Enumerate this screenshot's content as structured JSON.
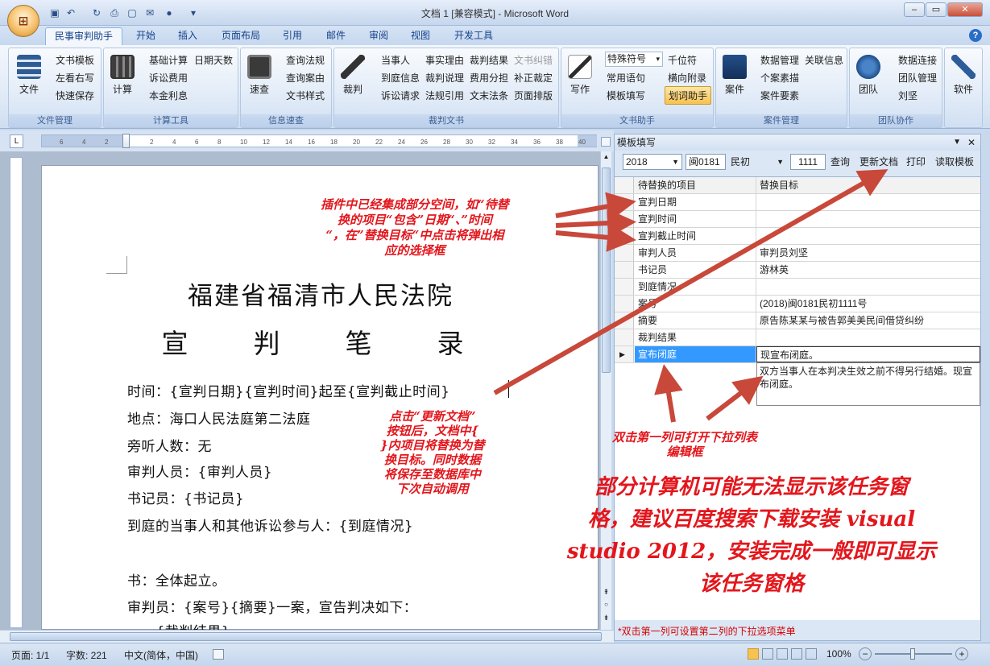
{
  "window": {
    "title": "文档 1 [兼容模式] - Microsoft Word",
    "office_button": "Office",
    "min": "–",
    "max": "▭",
    "close": "✕"
  },
  "quick_access": [
    "save-icon",
    "undo-icon",
    "redo-icon",
    "print-preview-icon",
    "new-icon",
    "mail-icon",
    "spell-icon"
  ],
  "tabs": [
    "民事审判助手",
    "开始",
    "插入",
    "页面布局",
    "引用",
    "邮件",
    "审阅",
    "视图",
    "开发工具"
  ],
  "active_tab": "民事审判助手",
  "help": "?",
  "ribbon": {
    "file_mgmt": {
      "title": "文件管理",
      "big": "文件",
      "items": [
        "文书模板",
        "左看右写",
        "快速保存"
      ]
    },
    "calc": {
      "title": "计算工具",
      "big": "计算",
      "items": [
        "基础计算",
        "日期天数",
        "诉讼费用",
        "本金利息"
      ]
    },
    "info": {
      "title": "信息速查",
      "big": "速查",
      "items": [
        "查询法规",
        "查询案由",
        "文书样式"
      ]
    },
    "judgment": {
      "title": "裁判文书",
      "big": "裁判",
      "items": [
        "当事人",
        "事实理由",
        "裁判结果",
        "文书纠错",
        "到庭信息",
        "裁判说理",
        "费用分担",
        "补正裁定",
        "诉讼请求",
        "法规引用",
        "文末法条",
        "页面排版"
      ]
    },
    "assistant": {
      "title": "文书助手",
      "big": "写作",
      "items": [
        "特殊符号",
        "千位符",
        "常用语句",
        "横向附录",
        "模板填写",
        "划词助手"
      ]
    },
    "case_mgmt": {
      "title": "案件管理",
      "big": "案件",
      "items": [
        "数据管理",
        "关联信息",
        "个案素描",
        "案件要素"
      ]
    },
    "team": {
      "title": "团队协作",
      "big": "团队",
      "items": [
        "数据连接",
        "团队管理",
        "刘坚"
      ]
    },
    "software": {
      "big": "软件"
    }
  },
  "ruler": {
    "ticks": [
      "6",
      "4",
      "2",
      "",
      "2",
      "4",
      "6",
      "8",
      "10",
      "12",
      "14",
      "16",
      "18",
      "20",
      "22",
      "24",
      "26",
      "28",
      "30",
      "32",
      "34",
      "36",
      "38",
      "40"
    ]
  },
  "document": {
    "court": "福建省福清市人民法院",
    "doc_title": "宣  判  笔  录",
    "lines": [
      "时间：{宣判日期}{宣判时间}起至{宣判截止时间}",
      "地点：海口人民法庭第二法庭",
      "旁听人数：无",
      "审判人员：{审判人员}",
      "书记员：{书记员}",
      "到庭的当事人和其他诉讼参与人：{到庭情况}",
      "",
      "书：全体起立。",
      "审判员：{案号}{摘要}一案，宣告判决如下：",
      "      {裁判结果}"
    ]
  },
  "pane": {
    "title": "模板填写",
    "year": "2018",
    "court_code": "闽0181",
    "case_type": "民初",
    "case_no": "1111",
    "buttons": [
      "查询",
      "更新文档",
      "打印",
      "读取模板"
    ],
    "col1": "待替换的项目",
    "col2": "替换目标",
    "rows": [
      {
        "k": "宣判日期",
        "v": ""
      },
      {
        "k": "宣判时间",
        "v": ""
      },
      {
        "k": "宣判截止时间",
        "v": ""
      },
      {
        "k": "审判人员",
        "v": "审判员刘坚"
      },
      {
        "k": "书记员",
        "v": "游林英"
      },
      {
        "k": "到庭情况",
        "v": ""
      },
      {
        "k": "案号",
        "v": "(2018)闽0181民初1111号"
      },
      {
        "k": "摘要",
        "v": "原告陈某某与被告郭美美民间借贷纠纷"
      },
      {
        "k": "裁判结果",
        "v": ""
      },
      {
        "k": "宣布闭庭",
        "v": "现宣布闭庭。"
      }
    ],
    "dropdown_text": "双方当事人在本判决生效之前不得另行结婚。现宣布闭庭。",
    "footer": "*双击第一列可设置第二列的下拉选项菜单"
  },
  "status": {
    "page": "页面: 1/1",
    "words": "字数: 221",
    "lang": "中文(简体，中国)",
    "zoom": "100%"
  },
  "annotations": {
    "a1": [
      "插件中已经集成部分空间，如“待替",
      "换的项目“包含”日期“、”时间",
      "“，在”替换目标“中点击将弹出相",
      "应的选择框"
    ],
    "a2": [
      "点击“更新文档”",
      "按钮后，文档中{",
      "}内项目将替换为替",
      "换目标。同时数据",
      "将保存至数据库中",
      "下次自动调用"
    ],
    "a3": [
      "双击第一列可打开下拉列表",
      "编辑框"
    ],
    "a4": [
      "部分计算机可能无法显示该任务窗",
      "格，建议百度搜索下载安装 visual",
      "studio 2012，安装完成一般即可显示",
      "该任务窗格"
    ]
  },
  "colors": {
    "annotation": "#e3161c",
    "arrow": "#c8483a",
    "accent": "#15428b"
  }
}
